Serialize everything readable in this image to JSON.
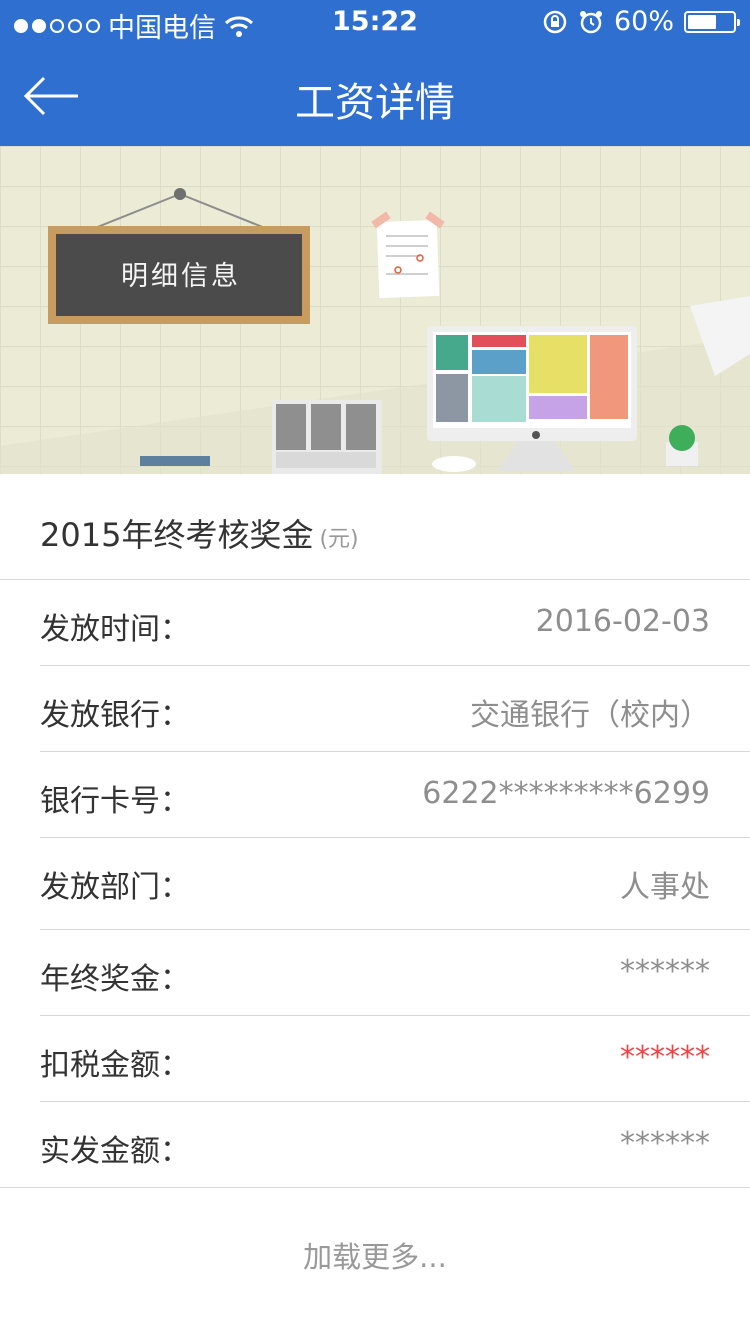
{
  "status_bar": {
    "carrier": "中国电信",
    "time": "15:22",
    "battery": "60%"
  },
  "nav": {
    "title": "工资详情"
  },
  "banner": {
    "chalkboard_text": "明细信息"
  },
  "section": {
    "title": "2015年终考核奖金",
    "unit": "(元)"
  },
  "details": [
    {
      "label": "发放时间：",
      "value": "2016-02-03"
    },
    {
      "label": "发放银行：",
      "value": "交通银行（校内）"
    },
    {
      "label": "银行卡号：",
      "value": "6222*********6299"
    },
    {
      "label": "发放部门：",
      "value": "人事处"
    },
    {
      "label": "年终奖金：",
      "value": "******"
    },
    {
      "label": "扣税金额：",
      "value": "******",
      "highlight": "#ef4444"
    },
    {
      "label": "实发金额：",
      "value": "******"
    }
  ],
  "load_more": "加载更多..."
}
